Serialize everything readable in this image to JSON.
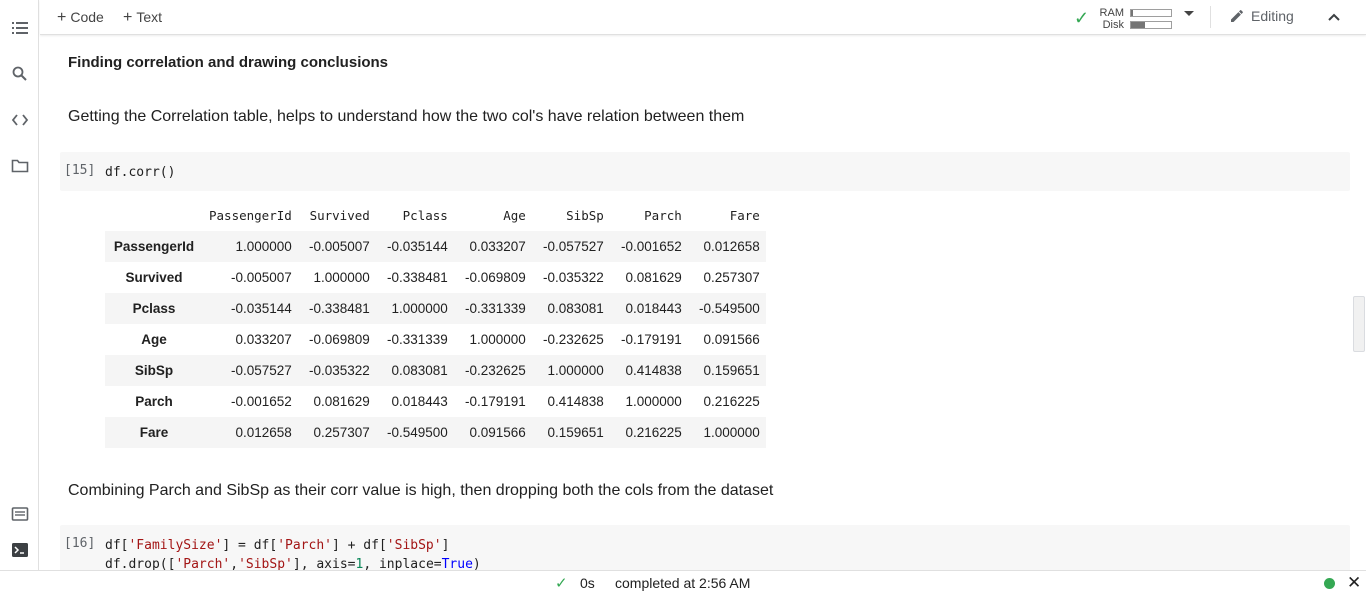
{
  "toolbar": {
    "code_label": "Code",
    "text_label": "Text",
    "ram_label": "RAM",
    "disk_label": "Disk",
    "ram_usage": 0.04,
    "disk_usage": 0.35,
    "editing_label": "Editing"
  },
  "notebook": {
    "heading": "Finding correlation and drawing conclusions",
    "paragraph1": "Getting the Correlation table, helps to understand how the two col's have relation between them",
    "cell1_prompt": "[15]",
    "cell1_code": "df.corr()",
    "paragraph2": "Combining Parch and SibSp as their corr value is high, then dropping both the cols from the dataset",
    "cell2_prompt": "[16]"
  },
  "corr_table": {
    "columns": [
      "PassengerId",
      "Survived",
      "Pclass",
      "Age",
      "SibSp",
      "Parch",
      "Fare"
    ],
    "rows": [
      {
        "label": "PassengerId",
        "values": [
          "1.000000",
          "-0.005007",
          "-0.035144",
          "0.033207",
          "-0.057527",
          "-0.001652",
          "0.012658"
        ]
      },
      {
        "label": "Survived",
        "values": [
          "-0.005007",
          "1.000000",
          "-0.338481",
          "-0.069809",
          "-0.035322",
          "0.081629",
          "0.257307"
        ]
      },
      {
        "label": "Pclass",
        "values": [
          "-0.035144",
          "-0.338481",
          "1.000000",
          "-0.331339",
          "0.083081",
          "0.018443",
          "-0.549500"
        ]
      },
      {
        "label": "Age",
        "values": [
          "0.033207",
          "-0.069809",
          "-0.331339",
          "1.000000",
          "-0.232625",
          "-0.179191",
          "0.091566"
        ]
      },
      {
        "label": "SibSp",
        "values": [
          "-0.057527",
          "-0.035322",
          "0.083081",
          "-0.232625",
          "1.000000",
          "0.414838",
          "0.159651"
        ]
      },
      {
        "label": "Parch",
        "values": [
          "-0.001652",
          "0.081629",
          "0.018443",
          "-0.179191",
          "0.414838",
          "1.000000",
          "0.216225"
        ]
      },
      {
        "label": "Fare",
        "values": [
          "0.012658",
          "0.257307",
          "-0.549500",
          "0.091566",
          "0.159651",
          "0.216225",
          "1.000000"
        ]
      }
    ]
  },
  "status": {
    "duration": "0s",
    "completed": "completed at 2:56 AM"
  },
  "colors": {
    "accent_green": "#34a853",
    "string": "#a31515",
    "number": "#098658",
    "keyword": "#0000ff"
  },
  "icons": {
    "rail": [
      "toc-icon",
      "search-icon",
      "code-snippets-icon",
      "folder-icon",
      "command-palette-icon",
      "terminal-icon"
    ],
    "toolbar": [
      "plus-icon",
      "check-icon",
      "chevron-down-icon",
      "pencil-icon",
      "chevron-up-icon"
    ],
    "status": [
      "check-icon",
      "status-dot-icon",
      "close-icon"
    ]
  }
}
